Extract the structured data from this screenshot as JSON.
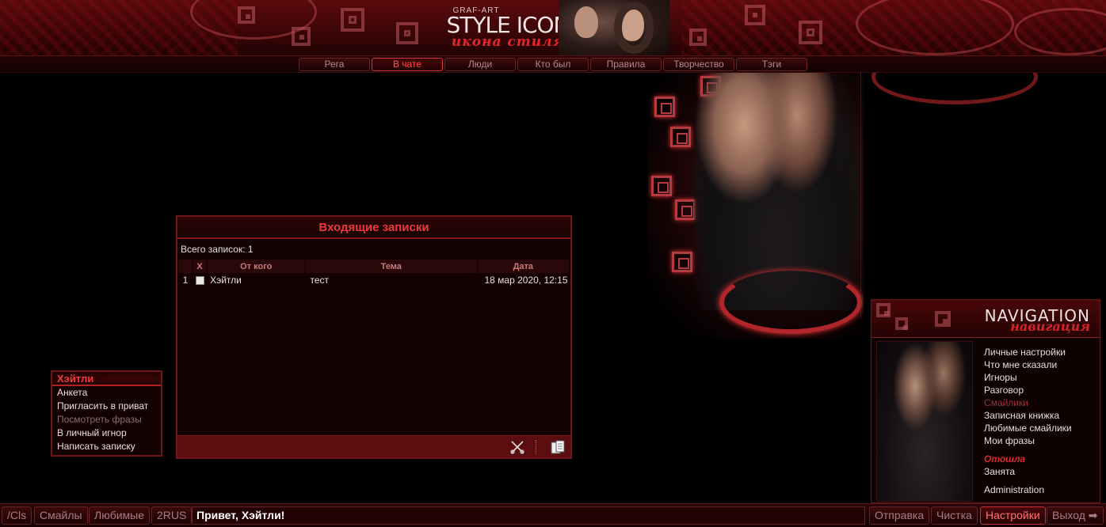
{
  "header": {
    "logo_small": "GRAF-ART",
    "logo_big": "STYLE ICON",
    "logo_script": "икона стиля"
  },
  "nav": {
    "items": [
      {
        "label": "Рега",
        "active": false
      },
      {
        "label": "В чате",
        "active": true
      },
      {
        "label": "Люди",
        "active": false
      },
      {
        "label": "Кто был",
        "active": false
      },
      {
        "label": "Правила",
        "active": false
      },
      {
        "label": "Творчество",
        "active": false
      },
      {
        "label": "Тэги",
        "active": false
      }
    ]
  },
  "inbox": {
    "title": "Входящие записки",
    "count_text": "Всего записок: 1",
    "columns": [
      "",
      "X",
      "От кого",
      "Тема",
      "Дата"
    ],
    "rows": [
      {
        "num": "1",
        "from": "Хэйтли",
        "subject": "тест",
        "date": "18 мар 2020, 12:15"
      }
    ]
  },
  "usermenu": {
    "title": "Хэйтли",
    "items": [
      {
        "label": "Анкета",
        "dim": false
      },
      {
        "label": "Пригласить в приват",
        "dim": false
      },
      {
        "label": "Посмотреть фразы",
        "dim": true
      },
      {
        "label": "В личный игнор",
        "dim": false
      },
      {
        "label": "Написать записку",
        "dim": false
      }
    ]
  },
  "navpanel": {
    "title": "NAVIGATION",
    "script": "навигация",
    "links": [
      "Личные настройки",
      "Что мне сказали",
      "Игноры",
      "Разговор",
      "Смайлики",
      "Записная книжка",
      "Любимые смайлики",
      "Мои фразы"
    ],
    "status": [
      "Отошла",
      "Занята"
    ],
    "admin": "Administration"
  },
  "bottom": {
    "left_buttons": [
      "/Cls",
      "Смайлы",
      "Любимые",
      "2RUS"
    ],
    "greeting": "Привет, Хэйтли!",
    "right_buttons": [
      "Отправка",
      "Чистка",
      "Настройки",
      "Выход ➡"
    ]
  }
}
